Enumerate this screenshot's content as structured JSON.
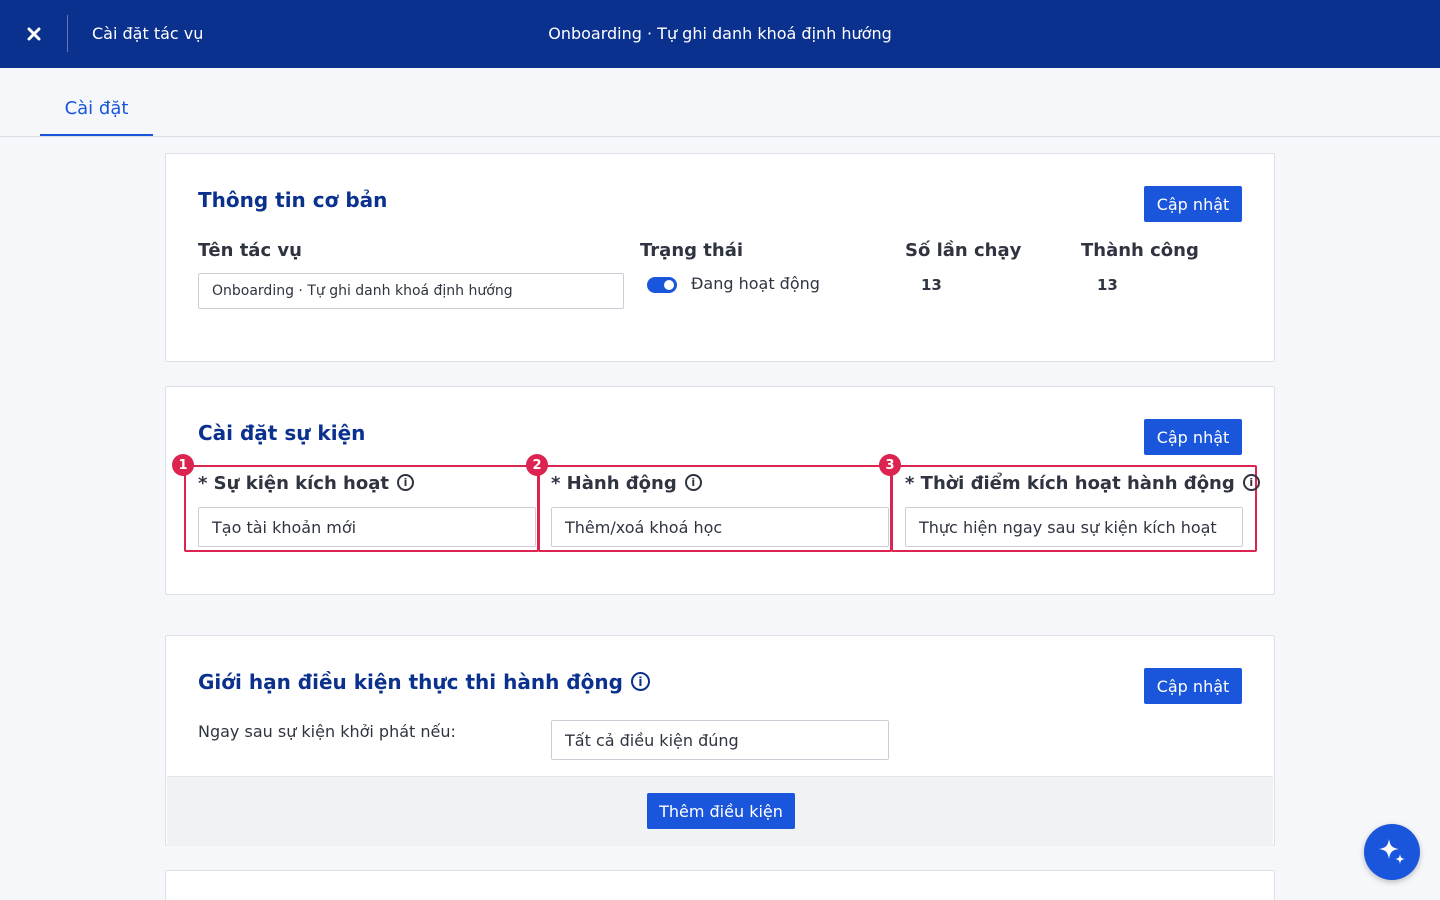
{
  "topbar": {
    "left_title": "Cài đặt tác vụ",
    "center_title": "Onboarding · Tự ghi danh khoá định hướng"
  },
  "tabs": [
    {
      "label": "Cài đặt",
      "active": true
    }
  ],
  "basic_info": {
    "title": "Thông tin cơ bản",
    "update_label": "Cập nhật",
    "name_label": "Tên tác vụ",
    "name_value": "Onboarding · Tự ghi danh khoá định hướng",
    "status_label": "Trạng thái",
    "status_value": "Đang hoạt động",
    "runs_label": "Số lần chạy",
    "runs_value": "13",
    "success_label": "Thành công",
    "success_value": "13"
  },
  "event_settings": {
    "title": "Cài đặt sự kiện",
    "update_label": "Cập nhật",
    "fields": [
      {
        "badge": "1",
        "label": "* Sự kiện kích hoạt",
        "value": "Tạo tài khoản mới"
      },
      {
        "badge": "2",
        "label": "* Hành động",
        "value": "Thêm/xoá khoá học"
      },
      {
        "badge": "3",
        "label": "* Thời điểm kích hoạt hành động",
        "value": "Thực hiện ngay sau sự kiện kích hoạt"
      }
    ]
  },
  "conditions": {
    "title": "Giới hạn điều kiện thực thi hành động",
    "update_label": "Cập nhật",
    "trigger_label": "Ngay sau sự kiện khởi phát nếu:",
    "trigger_value": "Tất cả điều kiện đúng",
    "add_label": "Thêm điều kiện"
  },
  "colors": {
    "header_bg": "#0b318f",
    "primary": "#1a56db",
    "highlight": "#dc2450"
  }
}
